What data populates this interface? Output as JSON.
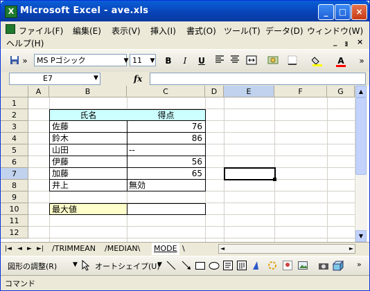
{
  "window": {
    "title": "Microsoft Excel - ave.xls",
    "app_icon": "X",
    "minimize_glyph": "_",
    "maximize_glyph": "□",
    "close_glyph": "×"
  },
  "menu": {
    "items": [
      "ファイル(F)",
      "編集(E)",
      "表示(V)",
      "挿入(I)",
      "書式(O)",
      "ツール(T)",
      "データ(D)",
      "ウィンドウ(W)"
    ],
    "help": "ヘルプ(H)",
    "doc_minimize": "_",
    "doc_restore": "ｮ",
    "doc_close": "×"
  },
  "toolbar": {
    "save_icon": "save-icon",
    "more_glyph": "»",
    "font_name": "MS Pゴシック",
    "font_size": "11",
    "bold": "B",
    "italic": "I",
    "underline": "U",
    "font_color_label": "A"
  },
  "formula_bar": {
    "name_box": "E7",
    "fx": "fx",
    "content": ""
  },
  "sheet": {
    "columns": [
      "A",
      "B",
      "C",
      "D",
      "E",
      "F",
      "G"
    ],
    "rows": [
      "1",
      "2",
      "3",
      "4",
      "5",
      "6",
      "7",
      "8",
      "9",
      "10",
      "11",
      "12"
    ],
    "selected_column": "E",
    "selected_row": "7",
    "header_name": "氏名",
    "header_score": "得点",
    "names": [
      "佐藤",
      "鈴木",
      "山田",
      "伊藤",
      "加藤",
      "井上"
    ],
    "scores": [
      "76",
      "86",
      "--",
      "56",
      "65",
      "無効"
    ],
    "max_label": "最大値",
    "max_value": "",
    "accent_header": "#ccffff",
    "accent_max": "#ffffcc"
  },
  "tabs": {
    "items": [
      "TRIMMEAN",
      "MEDIAN",
      "MODE"
    ],
    "active": "MODE"
  },
  "drawing": {
    "adjust": "図形の調整(R)",
    "autoshape": "オートシェイプ(U)"
  },
  "status": {
    "text": "コマンド"
  }
}
